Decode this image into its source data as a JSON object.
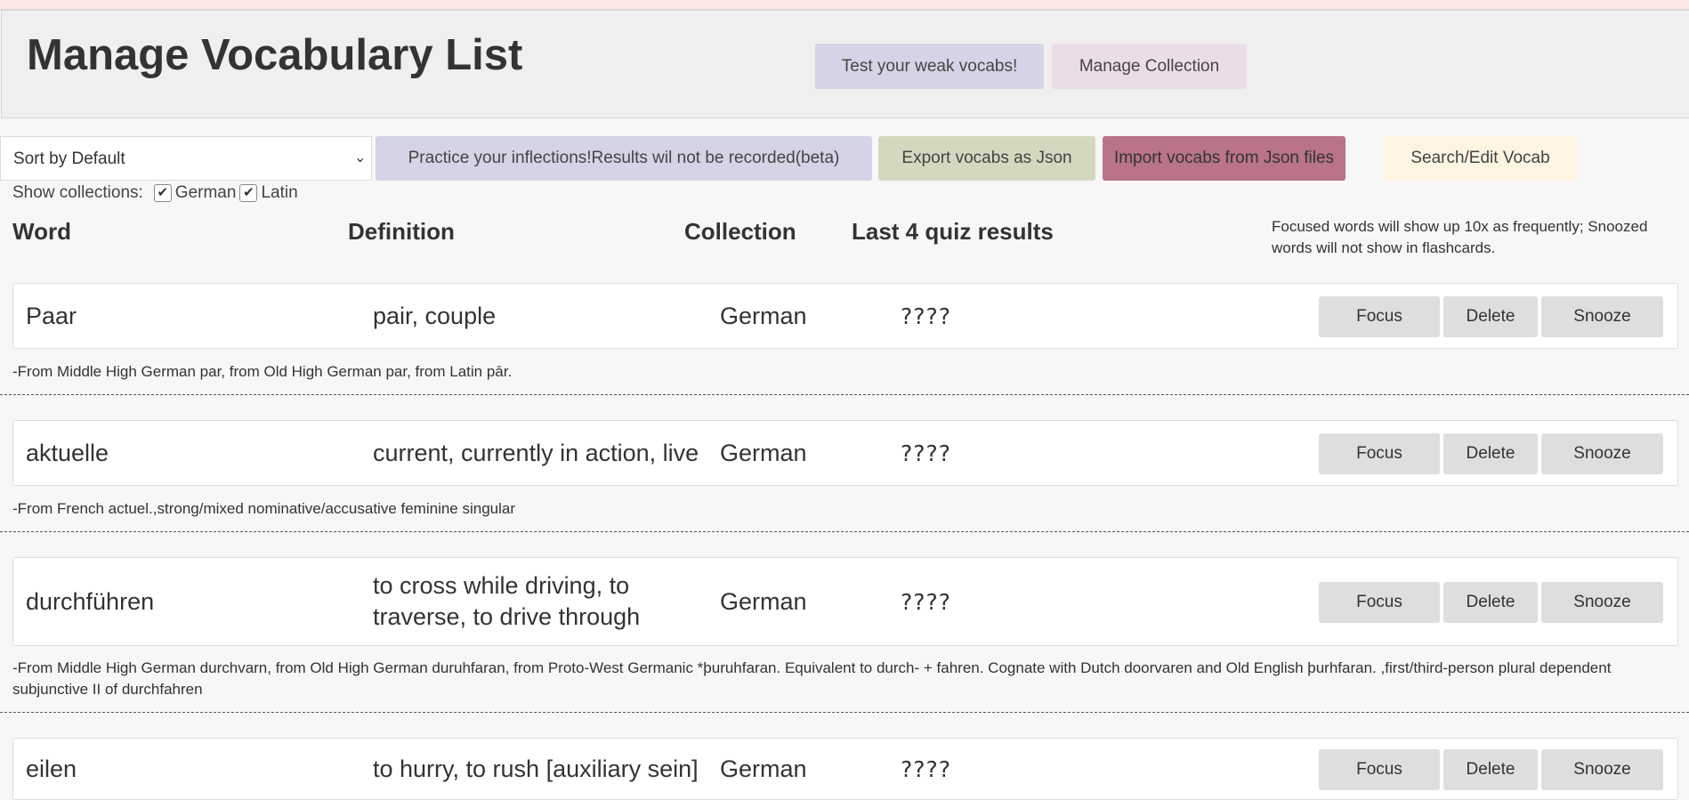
{
  "header": {
    "title": "Manage Vocabulary List",
    "weak_button": "Test your weak vocabs!",
    "manage_button": "Manage Collection"
  },
  "toolbar": {
    "sort_selected": "Sort by Default",
    "practice_button": "Practice your inflections!Results wil not be recorded(beta)",
    "export_button": "Export vocabs as Json",
    "import_button": "Import vocabs from Json files",
    "search_button": "Search/Edit Vocab"
  },
  "collections": {
    "label": "Show collections:",
    "options": [
      {
        "name": "German",
        "checked": true
      },
      {
        "name": "Latin",
        "checked": true
      }
    ]
  },
  "columns": {
    "word": "Word",
    "definition": "Definition",
    "collection": "Collection",
    "quiz": "Last 4 quiz results"
  },
  "hint": "Focused words will show up 10x as frequently; Snoozed words will not show in flashcards.",
  "actions": {
    "focus": "Focus",
    "delete": "Delete",
    "snooze": "Snooze"
  },
  "entries": [
    {
      "word": "Paar",
      "definition": "pair, couple",
      "collection": "German",
      "quiz": "????",
      "etymology": "-From Middle High German par, from Old High German par, from Latin pār."
    },
    {
      "word": "aktuelle",
      "definition": "current, currently in action, live",
      "collection": "German",
      "quiz": "????",
      "etymology": "-From French actuel.,strong/mixed nominative/accusative feminine singular"
    },
    {
      "word": "durchführen",
      "definition": "to cross while driving, to traverse, to drive through",
      "collection": "German",
      "quiz": "????",
      "etymology": "-From Middle High German durchvarn, from Old High German duruhfaran, from Proto-West Germanic *þuruhfaran. Equivalent to durch- + fahren. Cognate with Dutch doorvaren and Old English þurhfaran. ,first/third-person plural dependent subjunctive II of durchfahren"
    },
    {
      "word": "eilen",
      "definition": "to hurry, to rush [auxiliary sein]",
      "collection": "German",
      "quiz": "????",
      "etymology": ""
    }
  ]
}
